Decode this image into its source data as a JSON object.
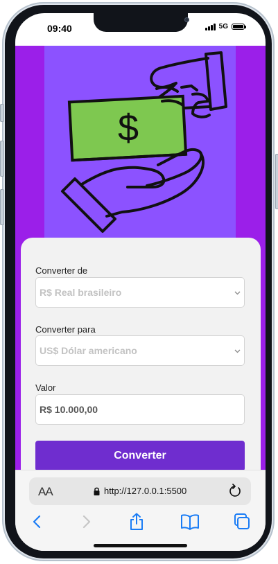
{
  "status_bar": {
    "time": "09:40",
    "network": "5G"
  },
  "form": {
    "from_label": "Converter de",
    "from_value": "R$ Real brasileiro",
    "to_label": "Converter para",
    "to_value": "US$ Dólar americano",
    "amount_label": "Valor",
    "amount_value": "R$ 10.000,00",
    "submit_label": "Converter"
  },
  "browser": {
    "text_size_label": "AA",
    "url": "http://127.0.0.1:5500"
  },
  "colors": {
    "page_bg": "#9b1fe9",
    "hero_bg": "#8c52ff",
    "banknote": "#7ec850",
    "button": "#6f2dcf",
    "ios_blue": "#1a7cf5"
  },
  "icons": [
    "money-hands-illustration",
    "dollar-icon",
    "chevron-down-icon",
    "lock-icon",
    "reload-icon",
    "back-icon",
    "forward-icon",
    "share-icon",
    "bookmarks-icon",
    "tabs-icon"
  ]
}
